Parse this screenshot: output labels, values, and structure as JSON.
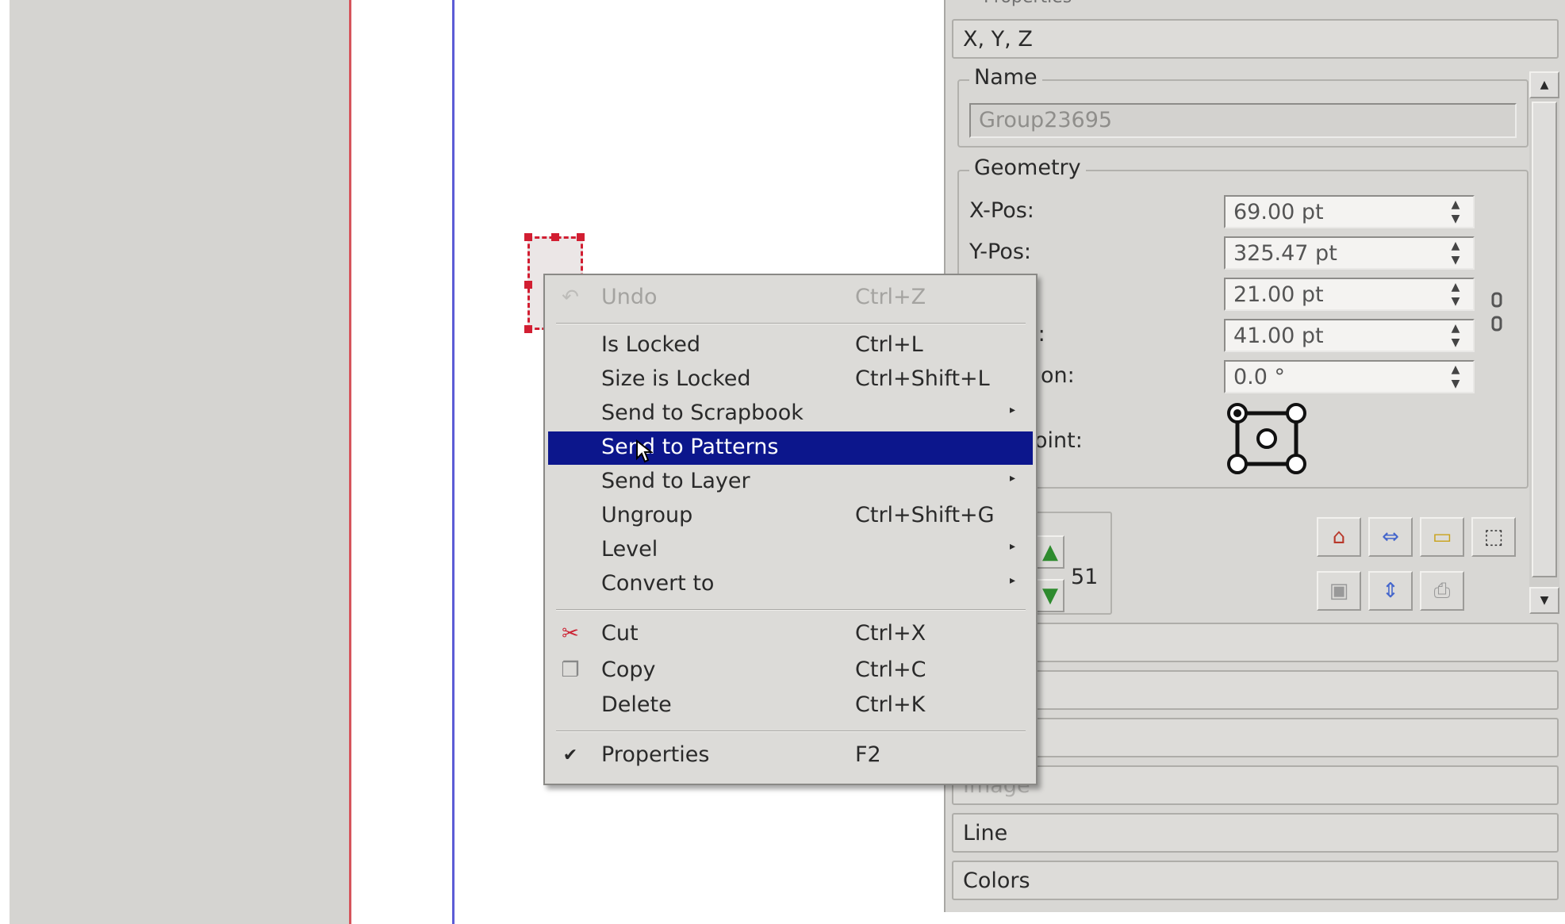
{
  "properties_panel": {
    "title": "Properties",
    "tab_xyz": "X, Y, Z",
    "name_group_label": "Name",
    "name_value": "Group23695",
    "geometry_group_label": "Geometry",
    "fields": [
      {
        "label": "X-Pos:",
        "value": "69.00 pt"
      },
      {
        "label": "Y-Pos:",
        "value": "325.47 pt"
      },
      {
        "label": "",
        "visible_label_fragment": ":",
        "value": "21.00 pt"
      },
      {
        "label": "",
        "visible_label_fragment": "t:",
        "value": "41.00 pt"
      },
      {
        "label": "",
        "visible_label_fragment": "on:",
        "value": "0.0 °"
      }
    ],
    "basepoint_label_fragment": "oint:",
    "level_value": "51",
    "collapsed_sections": [
      "Image",
      "Line",
      "Colors"
    ]
  },
  "context_menu": {
    "items": [
      {
        "label": "Undo",
        "shortcut": "Ctrl+Z",
        "disabled": true,
        "icon": "undo-icon"
      },
      {
        "separator": true
      },
      {
        "label": "Is Locked",
        "shortcut": "Ctrl+L"
      },
      {
        "label": "Size is Locked",
        "shortcut": "Ctrl+Shift+L"
      },
      {
        "label": "Send to Scrapbook",
        "submenu": true
      },
      {
        "label": "Send to Patterns",
        "highlighted": true
      },
      {
        "label": "Send to Layer",
        "submenu": true
      },
      {
        "label": "Ungroup",
        "shortcut": "Ctrl+Shift+G"
      },
      {
        "label": "Level",
        "submenu": true
      },
      {
        "label": "Convert to",
        "submenu": true
      },
      {
        "separator": true
      },
      {
        "label": "Cut",
        "shortcut": "Ctrl+X",
        "icon": "scissors-icon"
      },
      {
        "label": "Copy",
        "shortcut": "Ctrl+C",
        "icon": "copy-icon"
      },
      {
        "label": "Delete",
        "shortcut": "Ctrl+K"
      },
      {
        "separator": true
      },
      {
        "label": "Properties",
        "shortcut": "F2",
        "checked": true
      }
    ],
    "submenu_arrow": "▸",
    "check_mark": "✔"
  },
  "colors": {
    "menu_highlight": "#0c168c",
    "selection_red": "#d21e32",
    "page_edge": "#d5545c",
    "margin_guide": "#5c5cd6"
  }
}
